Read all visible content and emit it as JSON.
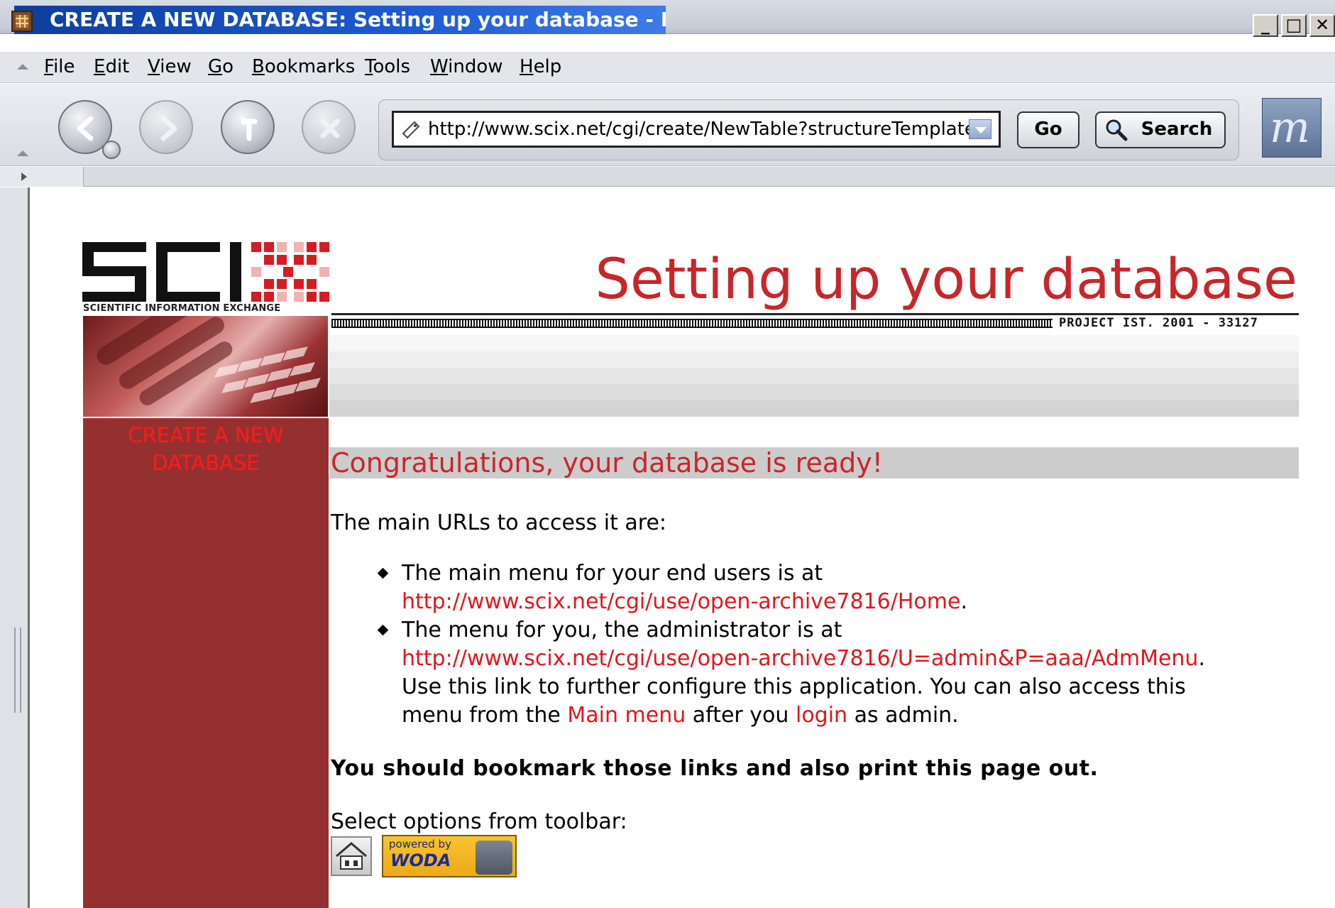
{
  "window": {
    "title": "CREATE A NEW DATABASE: Setting up your database - Mozilla",
    "controls": {
      "minimize": "_",
      "maximize": "□",
      "close": "✕"
    }
  },
  "menubar": {
    "items": [
      {
        "label": "File",
        "accel": "F",
        "rest": "ile"
      },
      {
        "label": "Edit",
        "accel": "E",
        "rest": "dit"
      },
      {
        "label": "View",
        "accel": "V",
        "rest": "iew"
      },
      {
        "label": "Go",
        "accel": "G",
        "rest": "o"
      },
      {
        "label": "Bookmarks",
        "accel": "B",
        "rest": "ookmarks"
      },
      {
        "label": "Tools",
        "accel": "T",
        "rest": "ools"
      },
      {
        "label": "Window",
        "accel": "W",
        "rest": "indow"
      },
      {
        "label": "Help",
        "accel": "H",
        "rest": "elp"
      }
    ]
  },
  "navbar": {
    "url": "http://www.scix.net/cgi/create/NewTable?structureTemplate=",
    "go_label": "Go",
    "search_label": "Search",
    "throbber_text": "m"
  },
  "header": {
    "logo_text": "SCIX",
    "logo_subtitle": "SCIENTIFIC INFORMATION EXCHANGE",
    "title": "Setting up your database",
    "project_code": "PROJECT IST. 2001 - 33127"
  },
  "sidebar": {
    "label": "CREATE A NEW DATABASE"
  },
  "content": {
    "banner": "Congratulations, your database is ready!",
    "intro": "The main URLs to access it are:",
    "bullet1_text": "The main menu for your end users is at",
    "bullet1_link": "http://www.scix.net/cgi/use/open-archive7816/Home",
    "bullet2_text": "The menu for you, the administrator is at",
    "bullet2_link": "http://www.scix.net/cgi/use/open-archive7816/U=admin&P=aaa/AdmMenu",
    "bullet2_more": "Use this link to further configure this application. You can also access this",
    "bullet2_pre": "menu from the",
    "main_menu_link": "Main menu",
    "bullet2_mid": "after you",
    "login_link": "login",
    "bullet2_end": "as admin.",
    "period": ".",
    "bookmark_note": "You should bookmark those links and also print this page out.",
    "toolbar_label": "Select options from toolbar:",
    "woda_powered": "powered by",
    "woda_name": "WODA"
  },
  "colors": {
    "accent_red": "#c8262a",
    "link_red": "#e2161b",
    "sidebar_maroon": "#953031",
    "titlebar_blue": "#0d3e9e"
  }
}
